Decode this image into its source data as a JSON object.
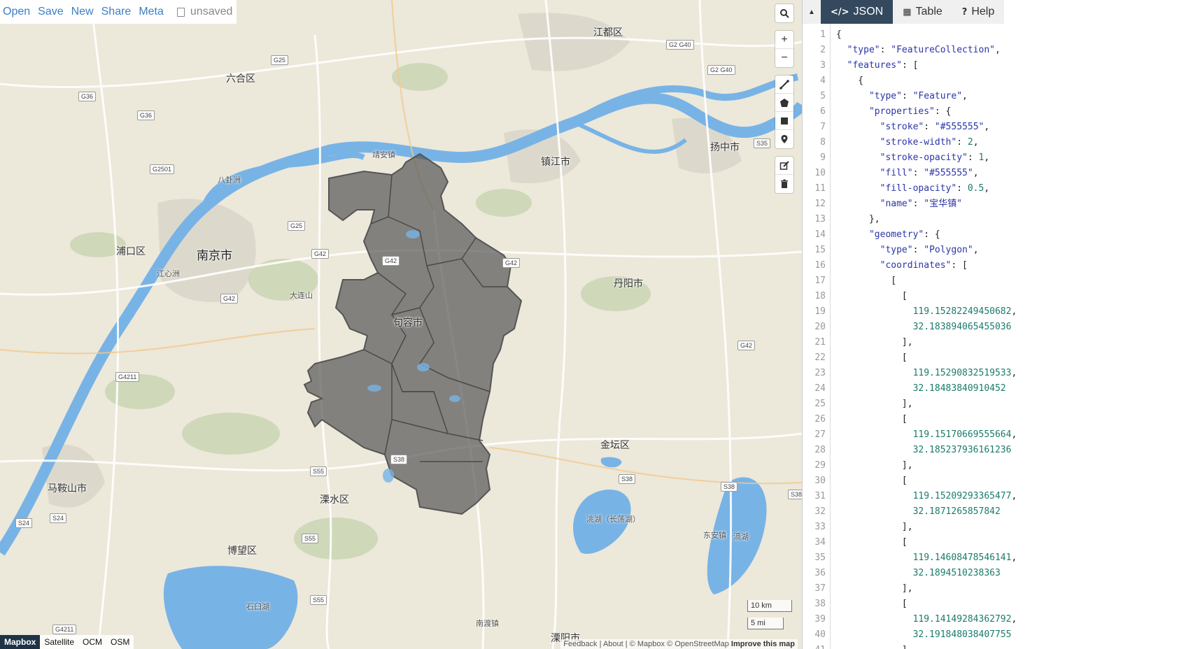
{
  "menu": {
    "items": [
      "Open",
      "Save",
      "New",
      "Share",
      "Meta"
    ],
    "file_status": "unsaved"
  },
  "map": {
    "places": {
      "jiangdu": "江都区",
      "liuhe": "六合区",
      "jingan": "靖安镇",
      "zhenjiang": "镇江市",
      "yangzhong": "扬中市",
      "pukou": "浦口区",
      "nanjing": "南京市",
      "jurong": "句容市",
      "danyang": "丹阳市",
      "jintan": "金坛区",
      "maanshan": "马鞍山市",
      "lishui": "溧水区",
      "bowang": "博望区",
      "nandu": "南渡镇",
      "liyang": "溧阳市",
      "dongan": "东安镇",
      "bagua": "八卦洲",
      "jiangxinzhou": "江心洲",
      "dalianshan": "大连山",
      "shijiu": "石臼湖",
      "changdang": "洮湖（长荡湖）",
      "gehu": "滆湖"
    },
    "shields": [
      "G25",
      "G36",
      "G36",
      "G2501",
      "G25",
      "G42",
      "G42",
      "G42",
      "G42",
      "G4211",
      "G4211",
      "S55",
      "S55",
      "S55",
      "S24",
      "S24",
      "S38",
      "S38",
      "S38",
      "S38",
      "S35",
      "G2 G40",
      "G2 G40",
      "G42"
    ],
    "scale": {
      "km": "10 km",
      "mi": "5 mi"
    },
    "layers": [
      "Mapbox",
      "Satellite",
      "OCM",
      "OSM"
    ],
    "active_layer": "Mapbox",
    "attribution": {
      "feedback": "Feedback",
      "sep1": "|",
      "about": "About",
      "sep2": "|",
      "mapbox": "© Mapbox",
      "osm": "© OpenStreetMap",
      "improve": "Improve this map"
    },
    "colors": {
      "land": "#ece8da",
      "water": "#78b3e6",
      "region_fill": "#555555",
      "region_stroke": "#555555"
    }
  },
  "controls": {
    "search": "search-icon",
    "zoom_in": "+",
    "zoom_out": "−",
    "draw": [
      "draw-line-icon",
      "draw-polygon-icon",
      "draw-rectangle-icon",
      "draw-marker-icon"
    ],
    "edit": [
      "edit-icon",
      "trash-icon"
    ]
  },
  "panel": {
    "collapse_icon": "▲",
    "tabs": [
      {
        "label": "JSON",
        "icon": "</>"
      },
      {
        "label": "Table",
        "icon": "▦"
      },
      {
        "label": "Help",
        "icon": "?"
      }
    ],
    "active_tab": "JSON",
    "line_numbers": [
      "1",
      "2",
      "3",
      "4",
      "5",
      "6",
      "7",
      "8",
      "9",
      "10",
      "11",
      "12",
      "13",
      "14",
      "15",
      "16",
      "17",
      "18",
      "19",
      "20",
      "21",
      "22",
      "23",
      "24",
      "25",
      "26",
      "27",
      "28",
      "29",
      "30",
      "31",
      "32",
      "33",
      "34",
      "35",
      "36",
      "37",
      "38",
      "39",
      "40",
      "41"
    ],
    "code_lines": [
      "{",
      "  \"type\": \"FeatureCollection\",",
      "  \"features\": [",
      "    {",
      "      \"type\": \"Feature\",",
      "      \"properties\": {",
      "        \"stroke\": \"#555555\",",
      "        \"stroke-width\": 2,",
      "        \"stroke-opacity\": 1,",
      "        \"fill\": \"#555555\",",
      "        \"fill-opacity\": 0.5,",
      "        \"name\": \"宝华镇\"",
      "      },",
      "      \"geometry\": {",
      "        \"type\": \"Polygon\",",
      "        \"coordinates\": [",
      "          [",
      "            [",
      "              119.15282249450682,",
      "              32.183894065455036",
      "            ],",
      "            [",
      "              119.15290832519533,",
      "              32.18483840910452",
      "            ],",
      "            [",
      "              119.15170669555664,",
      "              32.185237936161236",
      "            ],",
      "            [",
      "              119.15209293365477,",
      "              32.1871265857842",
      "            ],",
      "            [",
      "              119.14608478546141,",
      "              32.1894510238363",
      "            ],",
      "            [",
      "              119.14149284362792,",
      "              32.191848038407755",
      "            ],",
      "            ["
    ]
  }
}
